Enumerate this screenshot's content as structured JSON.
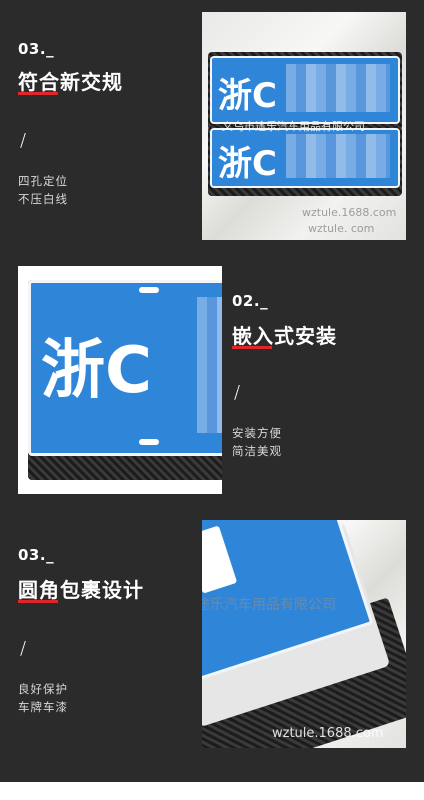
{
  "sections": [
    {
      "number": "03._",
      "title": "符合新交规",
      "lines": [
        "四孔定位",
        "不压白线"
      ]
    },
    {
      "number": "02._",
      "title": "嵌入式安装",
      "lines": [
        "安装方便",
        "简洁美观"
      ]
    },
    {
      "number": "03._",
      "title": "圆角包裹设计",
      "lines": [
        "良好保护",
        "车牌车漆"
      ]
    }
  ],
  "slash": "/",
  "photos": {
    "photo1": {
      "plate_top": "浙C",
      "plate_bottom": "浙C",
      "watermark_cn": "义乌市途乐汽车用品有限公司",
      "watermark_url": "wztule.1688.com",
      "watermark_url2": "wztule. com"
    },
    "photo2": {
      "plate": "浙C"
    },
    "photo3": {
      "watermark_cn": "途乐汽车用品有限公司",
      "watermark_url": "wztule.1688.com"
    }
  },
  "colors": {
    "panel": "#2b2b2b",
    "accent": "#e0262a",
    "plate_blue": "#2f86d8"
  }
}
